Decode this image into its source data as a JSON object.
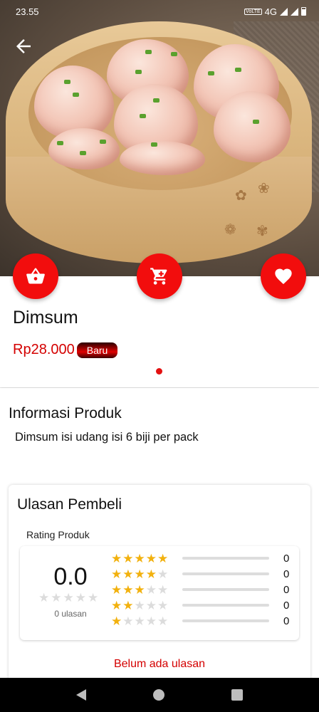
{
  "status_bar": {
    "time": "23.55",
    "network": "4G",
    "volte": "VoLTE"
  },
  "product": {
    "name": "Dimsum",
    "price": "Rp28.000",
    "badge": "Baru"
  },
  "info": {
    "title": "Informasi Produk",
    "description": "Dimsum isi udang isi 6 biji per pack"
  },
  "reviews": {
    "title": "Ulasan Pembeli",
    "rating_label": "Rating Produk",
    "average": "0.0",
    "average_stars": 0,
    "count_label": "0 ulasan",
    "breakdown": [
      {
        "stars": 5,
        "count": "0",
        "fraction": 0
      },
      {
        "stars": 4,
        "count": "0",
        "fraction": 0
      },
      {
        "stars": 3,
        "count": "0",
        "fraction": 0
      },
      {
        "stars": 2,
        "count": "0",
        "fraction": 0
      },
      {
        "stars": 1,
        "count": "0",
        "fraction": 0
      }
    ],
    "empty_text": "Belum ada ulasan"
  },
  "icons": {
    "back": "arrow-left-icon",
    "basket": "basket-icon",
    "cart": "cart-icon",
    "favorite": "heart-icon"
  },
  "colors": {
    "accent": "#f20d0d",
    "price": "#d40000",
    "star": "#f2b10e"
  },
  "carousel": {
    "pages": 1,
    "active": 1
  }
}
